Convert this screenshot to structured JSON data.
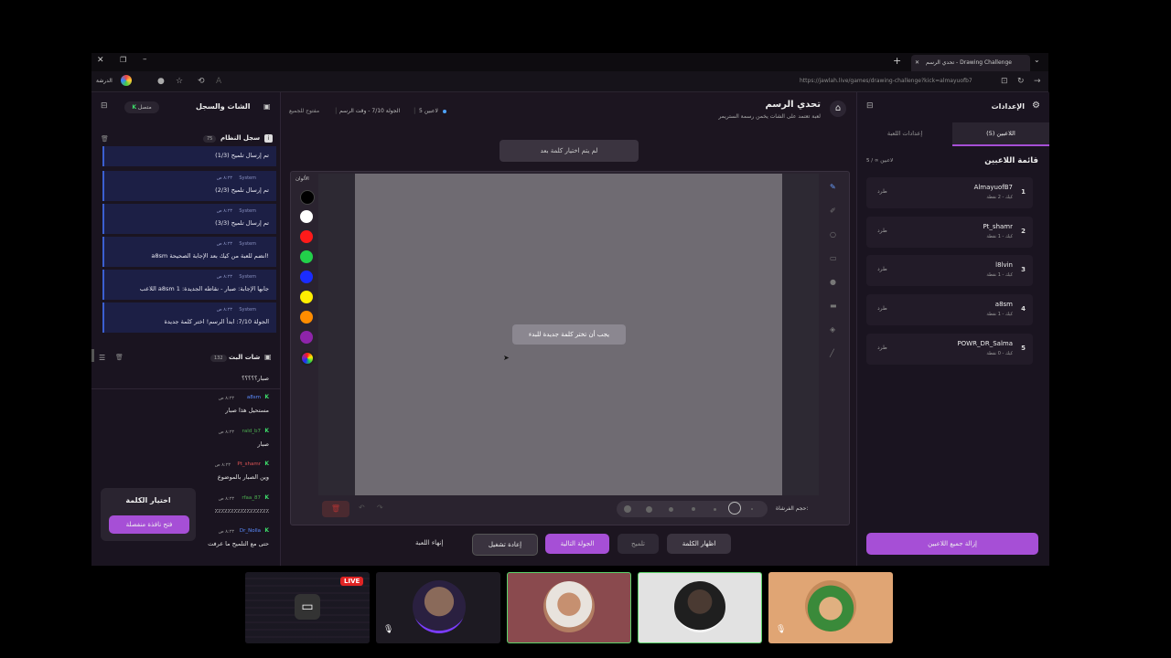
{
  "browser": {
    "tab_title": "تحدي الرسم - Drawing Challenge",
    "url": "https://jawlah.live/games/drawing-challenge?kick=almayuofb7",
    "profile_label": "الدرشة"
  },
  "left_panel": {
    "title": "الشات والسجل",
    "status": "متصل",
    "system_log": {
      "title": "سجل النظام",
      "count": "75",
      "messages": [
        {
          "sender": "",
          "time": "",
          "text": "تم إرسال تلميح (1/3)"
        },
        {
          "sender": "System",
          "time": "٨:٢٣ ص",
          "text": "تم إرسال تلميح (2/3)"
        },
        {
          "sender": "System",
          "time": "٨:٢٣ ص",
          "text": "تم إرسال تلميح (3/3)"
        },
        {
          "sender": "System",
          "time": "٨:٢٣ ص",
          "text": "a8sm انضم للعبة من كيك بعد الإجابة الصحيحة!"
        },
        {
          "sender": "System",
          "time": "٨:٢٣ ص",
          "text": "اللاعب a8sm جابها الإجابة: صبار - نقاطه الجديدة: 1"
        },
        {
          "sender": "System",
          "time": "٨:٢٣ ص",
          "text": "الجولة 7/10: ابدأ الرسم! اختر كلمة جديدة"
        }
      ]
    },
    "chat": {
      "title": "شات البث",
      "count": "132",
      "top_text": "صبار؟؟؟؟؟",
      "messages": [
        {
          "user": "a8sm",
          "time": "٨:٢٣ ص",
          "text": "مستحيل هذا صبار",
          "color": "#5b8cff"
        },
        {
          "user": "rald_b7",
          "time": "٨:٢٣ ص",
          "text": "صبار",
          "color": "#4caf50"
        },
        {
          "user": "Pt_shamr",
          "time": "٨:٢٣ ص",
          "text": "وين الصبار بالموضوع",
          "color": "#e05555"
        },
        {
          "user": "rfaa_87",
          "time": "٨:٢٣ ص",
          "text": "٪٪٪٪٪٪٪٪٪٪٪٪٪٪٪٪٪",
          "color": "#4caf50"
        },
        {
          "user": "Dr_Nolla",
          "time": "٨:٢٣ ص",
          "text": "حتى مع التلميح ما عرفت",
          "color": "#5b8cff"
        }
      ]
    },
    "word_popup": {
      "title": "اختيار الكلمة",
      "button": "فتح نافذة منفصلة"
    }
  },
  "center": {
    "game_title": "تحدي الرسم",
    "game_subtitle": "لعبة تعتمد على الشات يخمن رسمة الستريمر",
    "players_count": "5 لاعبين",
    "round_info": "الجولة 7/10 - وقت الرسم",
    "mode": "مفتوح للجميع",
    "word_status": "لم يتم اختيار كلمة بعد",
    "canvas_message": "يجب أن تختر كلمة جديدة للبدء",
    "colors_label": "الألوان",
    "brush_size_label": "حجم الفرشاة:",
    "buttons": {
      "show_word": "اظهار الكلمة",
      "hint": "تلميح",
      "next_round": "الجولة التالية",
      "restart": "إعادة تشغيل",
      "end_game": "إنهاء اللعبة"
    }
  },
  "colors": [
    "#000000",
    "#ffffff",
    "#ff1a1a",
    "#22d04a",
    "#1a2cff",
    "#ffee00",
    "#ff8c00",
    "#8e24aa"
  ],
  "accent": "#a64fd6",
  "right_panel": {
    "title": "الإعدادات",
    "tabs": [
      "اللاعبين (5)",
      "إعدادات اللعبة"
    ],
    "list_title": "قائمة اللاعبين",
    "list_count": "5 / ∞ لاعبين",
    "kick_label": "طرد",
    "players": [
      {
        "rank": "1",
        "name": "AlmayuofB7",
        "points": "كيك - 2 نقطة"
      },
      {
        "rank": "2",
        "name": "Pt_shamr",
        "points": "كيك - 1 نقطة"
      },
      {
        "rank": "3",
        "name": "l8lvin",
        "points": "كيك - 1 نقطة"
      },
      {
        "rank": "4",
        "name": "a8sm",
        "points": "كيك - 1 نقطة"
      },
      {
        "rank": "5",
        "name": "POWR_DR_Salma",
        "points": "كيك - 0 نقطة"
      }
    ],
    "remove_all": "إزالة جميع اللاعبين"
  },
  "video_strip": {
    "live_badge": "LIVE"
  }
}
